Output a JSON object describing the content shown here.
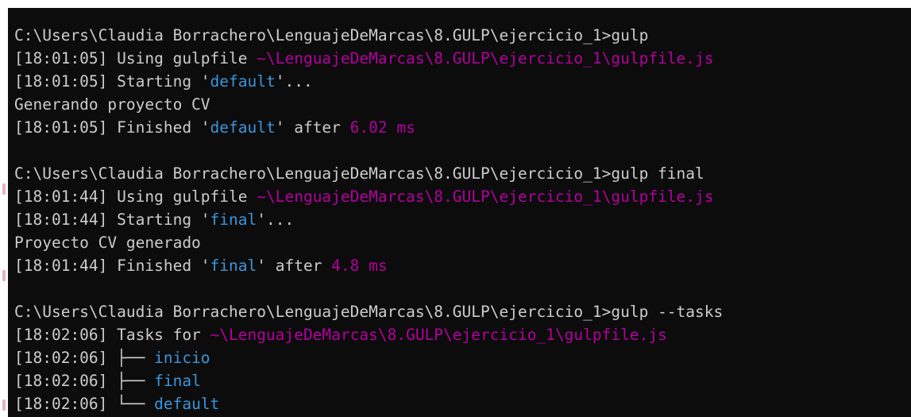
{
  "terminal": {
    "blocks": [
      {
        "lines": [
          {
            "segments": [
              {
                "text": "C:\\Users\\Claudia Borrachero\\LenguajeDeMarcas\\8.GULP\\ejercicio_1>gulp",
                "style": "plain"
              }
            ]
          },
          {
            "segments": [
              {
                "text": "[18:01:05] Using gulpfile ",
                "style": "plain"
              },
              {
                "text": "~\\LenguajeDeMarcas\\8.GULP\\ejercicio_1\\gulpfile.js",
                "style": "path"
              }
            ]
          },
          {
            "segments": [
              {
                "text": "[18:01:05] Starting '",
                "style": "plain"
              },
              {
                "text": "default",
                "style": "task"
              },
              {
                "text": "'...",
                "style": "plain"
              }
            ]
          },
          {
            "segments": [
              {
                "text": "Generando proyecto CV",
                "style": "plain"
              }
            ]
          },
          {
            "segments": [
              {
                "text": "[18:01:05] Finished '",
                "style": "plain"
              },
              {
                "text": "default",
                "style": "task"
              },
              {
                "text": "' after ",
                "style": "plain"
              },
              {
                "text": "6.02 ms",
                "style": "time"
              }
            ]
          }
        ]
      },
      {
        "lines": [
          {
            "segments": [
              {
                "text": "C:\\Users\\Claudia Borrachero\\LenguajeDeMarcas\\8.GULP\\ejercicio_1>gulp final",
                "style": "plain"
              }
            ]
          },
          {
            "segments": [
              {
                "text": "[18:01:44] Using gulpfile ",
                "style": "plain"
              },
              {
                "text": "~\\LenguajeDeMarcas\\8.GULP\\ejercicio_1\\gulpfile.js",
                "style": "path"
              }
            ]
          },
          {
            "segments": [
              {
                "text": "[18:01:44] Starting '",
                "style": "plain"
              },
              {
                "text": "final",
                "style": "task"
              },
              {
                "text": "'...",
                "style": "plain"
              }
            ]
          },
          {
            "segments": [
              {
                "text": "Proyecto CV generado",
                "style": "plain"
              }
            ]
          },
          {
            "segments": [
              {
                "text": "[18:01:44] Finished '",
                "style": "plain"
              },
              {
                "text": "final",
                "style": "task"
              },
              {
                "text": "' after ",
                "style": "plain"
              },
              {
                "text": "4.8 ms",
                "style": "time"
              }
            ]
          }
        ]
      },
      {
        "lines": [
          {
            "segments": [
              {
                "text": "C:\\Users\\Claudia Borrachero\\LenguajeDeMarcas\\8.GULP\\ejercicio_1>gulp --tasks",
                "style": "plain"
              }
            ]
          },
          {
            "segments": [
              {
                "text": "[18:02:06] Tasks for ",
                "style": "plain"
              },
              {
                "text": "~\\LenguajeDeMarcas\\8.GULP\\ejercicio_1\\gulpfile.js",
                "style": "path"
              }
            ]
          },
          {
            "segments": [
              {
                "text": "[18:02:06] ├── ",
                "style": "plain"
              },
              {
                "text": "inicio",
                "style": "cyan"
              }
            ]
          },
          {
            "segments": [
              {
                "text": "[18:02:06] ├── ",
                "style": "plain"
              },
              {
                "text": "final",
                "style": "cyan"
              }
            ]
          },
          {
            "segments": [
              {
                "text": "[18:02:06] └── ",
                "style": "plain"
              },
              {
                "text": "default",
                "style": "cyan"
              }
            ]
          }
        ]
      }
    ]
  },
  "colors": {
    "background": "#0c0c0c",
    "text": "#cccccc",
    "path": "#b4009e",
    "task": "#3a96dd",
    "time": "#b4009e"
  }
}
